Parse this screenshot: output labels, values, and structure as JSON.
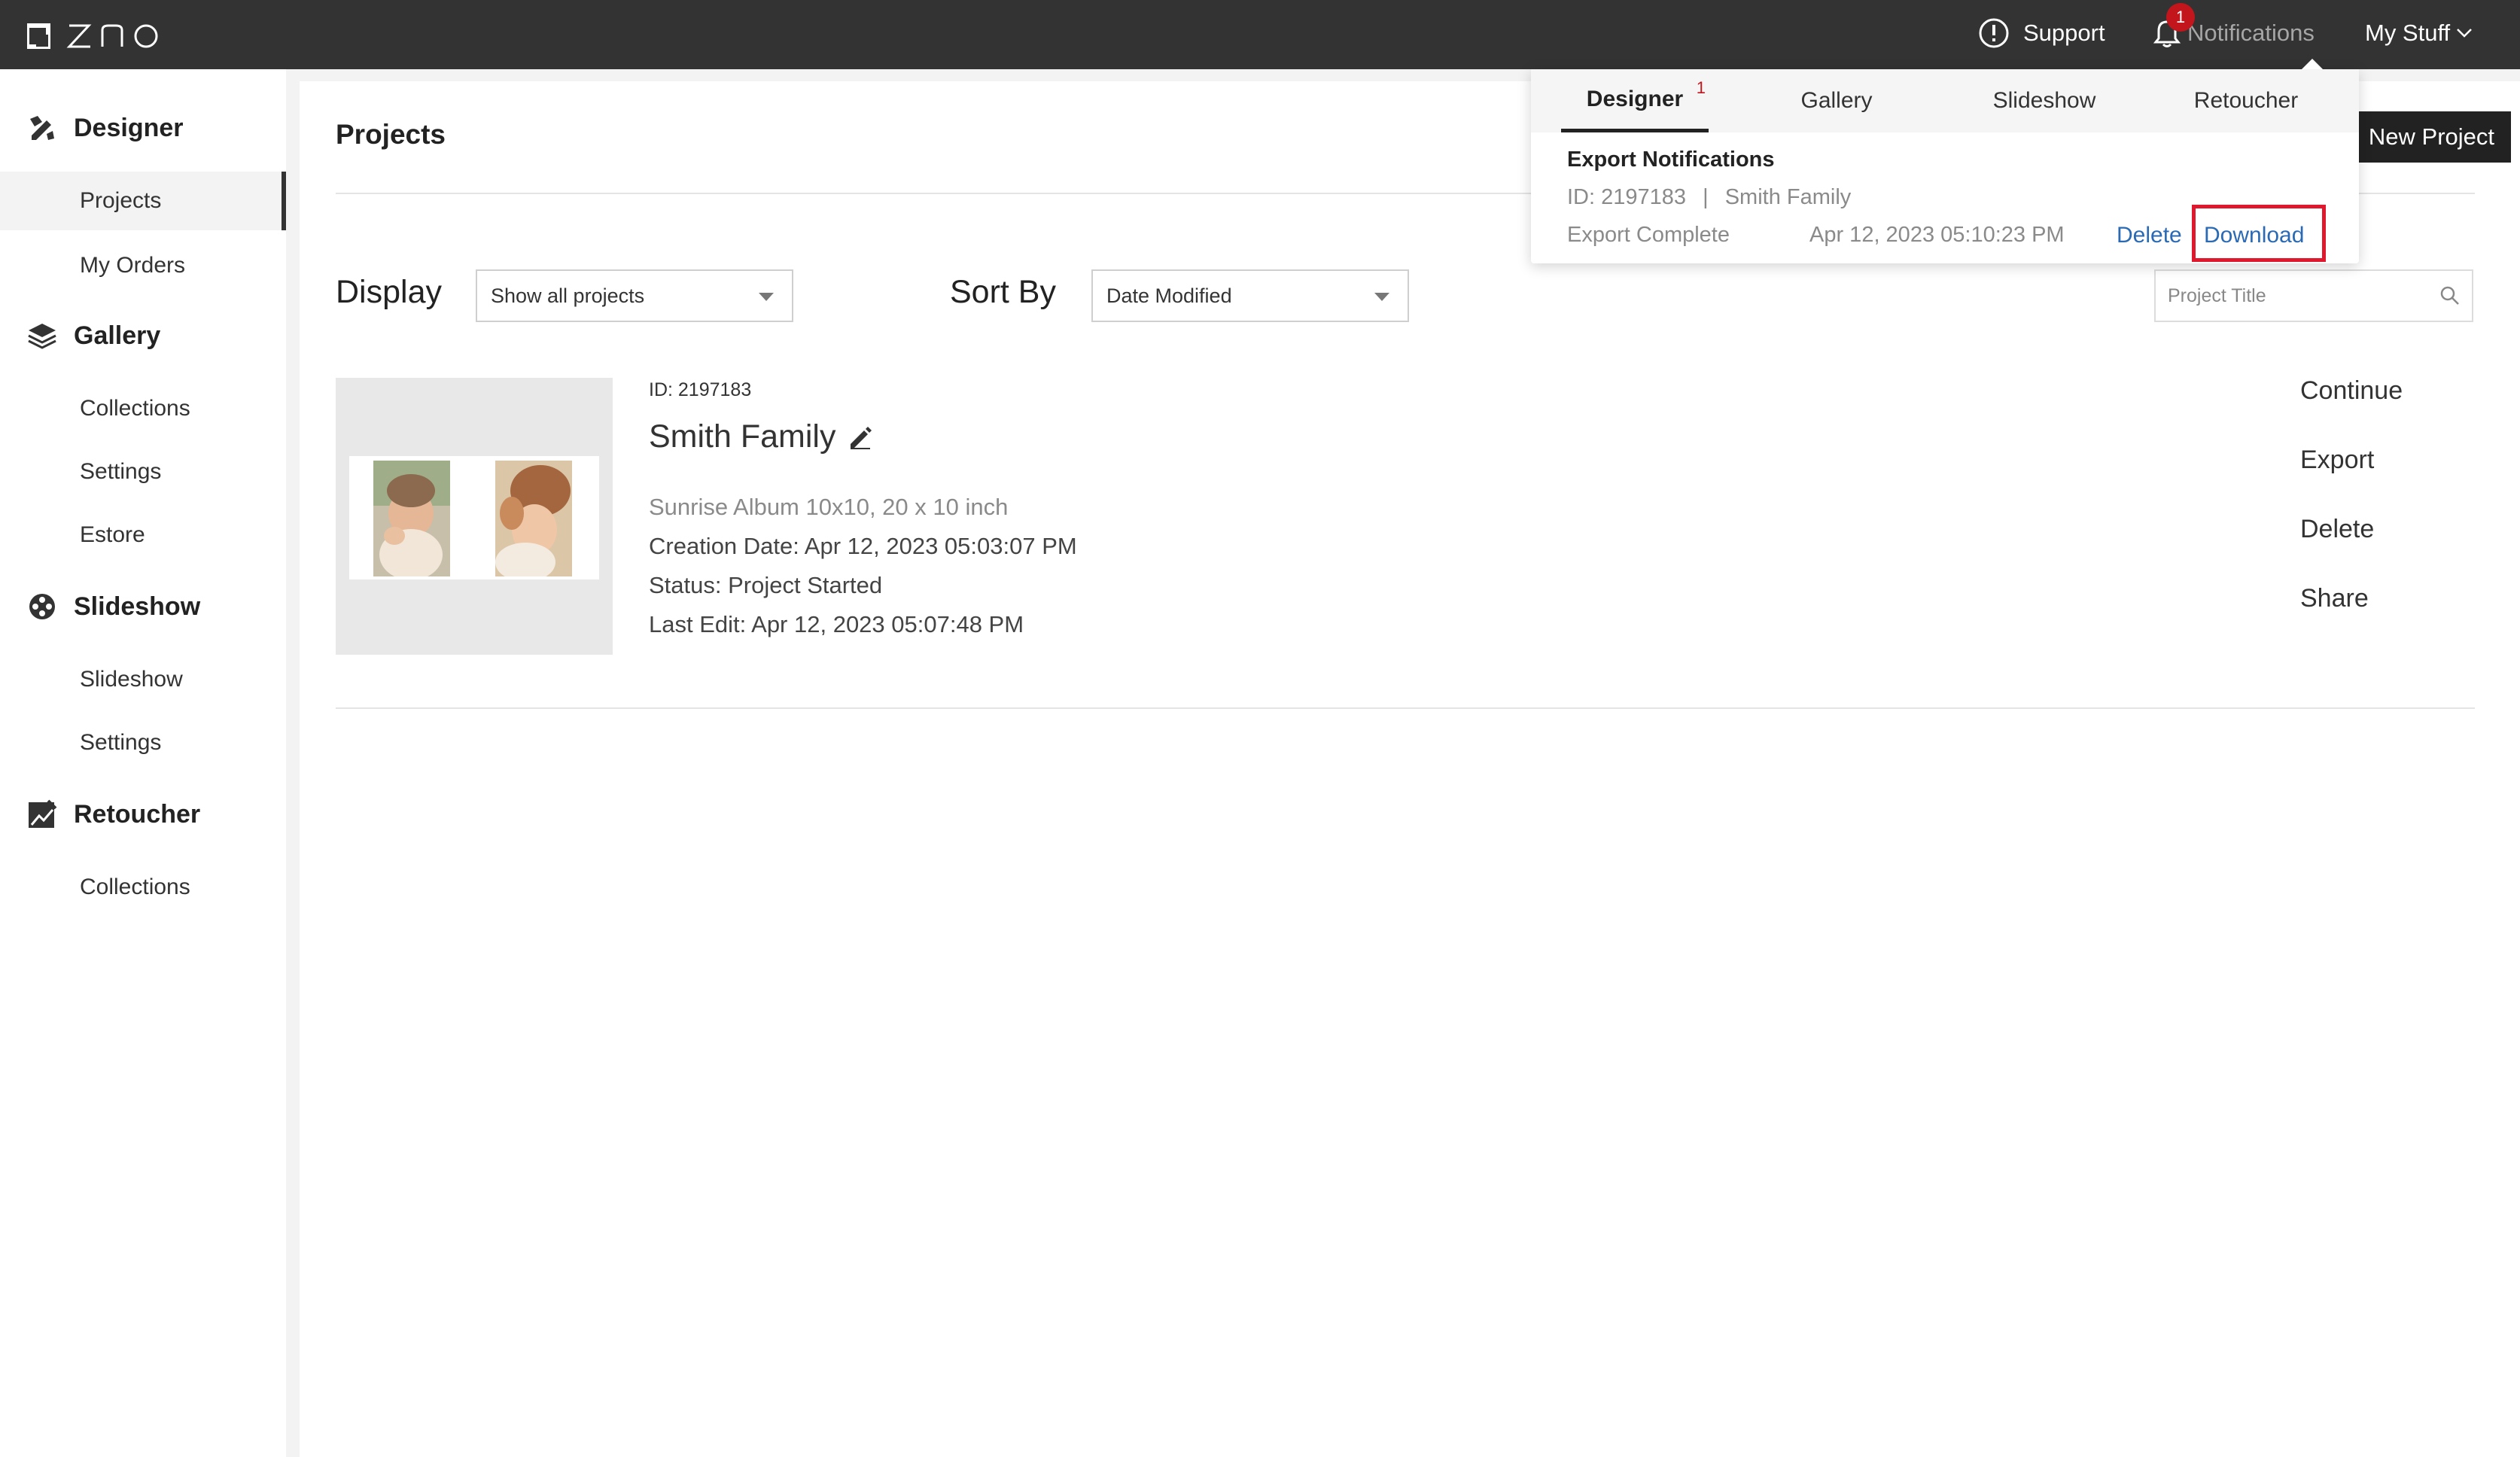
{
  "topbar": {
    "logo_text": "ZNO",
    "support_label": "Support",
    "notifications_label": "Notifications",
    "notifications_count": "1",
    "my_stuff_label": "My Stuff"
  },
  "sidebar": {
    "sections": [
      {
        "title": "Designer",
        "icon": "designer-icon",
        "items": [
          "Projects",
          "My Orders"
        ]
      },
      {
        "title": "Gallery",
        "icon": "layers-icon",
        "items": [
          "Collections",
          "Settings",
          "Estore"
        ]
      },
      {
        "title": "Slideshow",
        "icon": "film-reel-icon",
        "items": [
          "Slideshow",
          "Settings"
        ]
      },
      {
        "title": "Retoucher",
        "icon": "retoucher-icon",
        "items": [
          "Collections"
        ]
      }
    ],
    "active_item": "Projects"
  },
  "main": {
    "title": "Projects",
    "new_project_label": "New Project",
    "display_label": "Display",
    "display_value": "Show all projects",
    "sort_label": "Sort By",
    "sort_value": "Date Modified",
    "search_placeholder": "Project Title",
    "project": {
      "id": "ID: 2197183",
      "name": "Smith Family",
      "product": "Sunrise Album 10x10, 20 x 10 inch",
      "creation_date": "Creation Date: Apr 12, 2023 05:03:07 PM",
      "status": "Status: Project Started",
      "last_edit": "Last Edit: Apr 12, 2023 05:07:48 PM",
      "actions": [
        "Continue",
        "Export",
        "Delete",
        "Share"
      ]
    }
  },
  "notifications_panel": {
    "tabs": [
      {
        "label": "Designer",
        "badge": "1"
      },
      {
        "label": "Gallery"
      },
      {
        "label": "Slideshow"
      },
      {
        "label": "Retoucher"
      }
    ],
    "heading": "Export Notifications",
    "item_id": "ID: 2197183",
    "item_separator": "|",
    "item_name": "Smith Family",
    "item_status": "Export Complete",
    "item_time": "Apr 12, 2023 05:10:23 PM",
    "delete_label": "Delete",
    "download_label": "Download"
  },
  "colors": {
    "topbar_bg": "#333333",
    "link_blue": "#2a6ab5",
    "badge_red": "#c3161c",
    "highlight_red": "#e0182d"
  }
}
